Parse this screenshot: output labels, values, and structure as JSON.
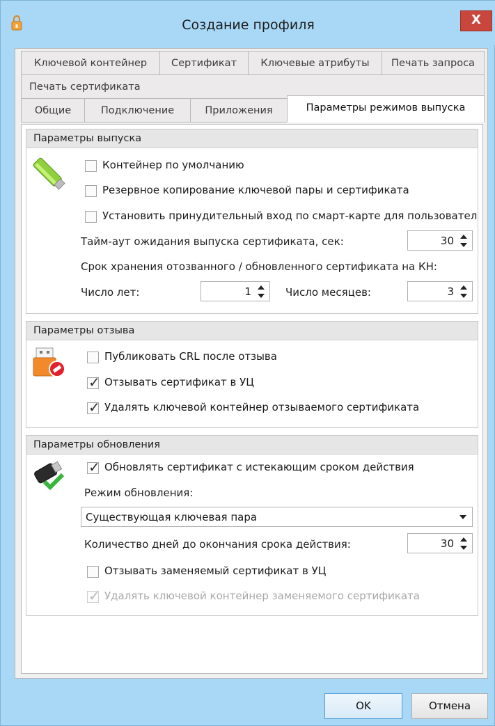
{
  "window": {
    "title": "Создание профиля",
    "close_label": "X"
  },
  "tabs": {
    "row1": [
      "Ключевой контейнер",
      "Сертификат",
      "Ключевые атрибуты",
      "Печать запроса"
    ],
    "row2": [
      "Печать сертификата"
    ],
    "row3": [
      "Общие",
      "Подключение",
      "Приложения",
      "Параметры режимов выпуска"
    ],
    "active": "Параметры режимов выпуска"
  },
  "issue_params": {
    "header": "Параметры выпуска",
    "default_container": {
      "label": "Контейнер по умолчанию",
      "checked": false
    },
    "backup_keypair": {
      "label": "Резервное копирование ключевой пары и сертификата",
      "checked": false
    },
    "force_smartcard": {
      "label": "Установить принудительный вход по смарт-карте для пользовател",
      "checked": false
    },
    "timeout_label": "Тайм-аут ожидания выпуска сертификата, сек:",
    "timeout_value": "30",
    "storage_label": "Срок хранения отозванного / обновленного сертификата на КН:",
    "years_label": "Число лет:",
    "years_value": "1",
    "months_label": "Число месяцев:",
    "months_value": "3"
  },
  "revoke_params": {
    "header": "Параметры отзыва",
    "publish_crl": {
      "label": "Публиковать CRL после отзыва",
      "checked": false
    },
    "revoke_in_ca": {
      "label": "Отзывать сертификат в УЦ",
      "checked": true
    },
    "delete_container": {
      "label": "Удалять ключевой контейнер отзываемого сертификата",
      "checked": true
    }
  },
  "update_params": {
    "header": "Параметры обновления",
    "renew_expiring": {
      "label": "Обновлять сертификат с истекающим сроком действия",
      "checked": true
    },
    "mode_label": "Режим обновления:",
    "mode_value": "Существующая ключевая пара",
    "days_label": "Количество дней до окончания срока действия:",
    "days_value": "30",
    "revoke_replaced": {
      "label": "Отзывать заменяемый сертификат в УЦ",
      "checked": false
    },
    "delete_replaced": {
      "label": "Удалять ключевой контейнер заменяемого сертификата",
      "checked": true,
      "disabled": true
    }
  },
  "buttons": {
    "ok": "OK",
    "cancel": "Отмена"
  },
  "colors": {
    "window_frame": "#a9d8f7",
    "close_button": "#c9463d",
    "client_bg": "#f0f0f0"
  },
  "icons": [
    "app-lock-icon",
    "usb-token-icon",
    "usb-revoke-icon",
    "usb-refresh-icon",
    "close-icon",
    "spin-arrows-icon",
    "dropdown-arrow-icon"
  ]
}
